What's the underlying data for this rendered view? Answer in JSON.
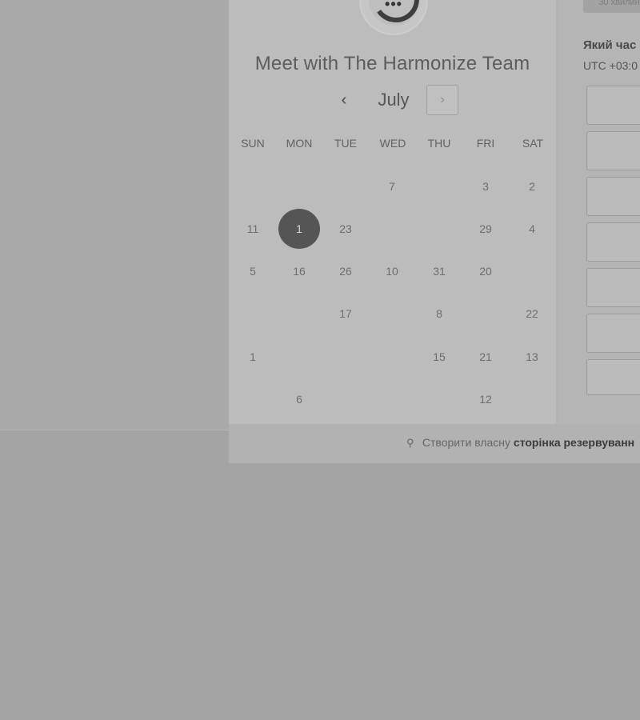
{
  "calendar": {
    "title": "Meet with The Harmonize Team",
    "month": "July",
    "prev_icon": "‹",
    "next_icon": "›",
    "weekdays": [
      "SUN",
      "MON",
      "TUE",
      "WED",
      "THU",
      "FRI",
      "SAT"
    ],
    "selected_day": "1",
    "rows": [
      [
        "",
        "",
        "",
        "7",
        "",
        "3",
        "2"
      ],
      [
        "11",
        "1",
        "23",
        "",
        "",
        "29",
        "4"
      ],
      [
        "5",
        "16",
        "26",
        "10",
        "31",
        "20",
        ""
      ],
      [
        "",
        "",
        "17",
        "",
        "8",
        "",
        "22"
      ],
      [
        "1",
        "",
        "",
        "",
        "15",
        "21",
        "13"
      ],
      [
        "",
        "6",
        "",
        "",
        "",
        "12",
        ""
      ]
    ]
  },
  "right": {
    "duration_label": "30 хвилин",
    "question": "Який час",
    "timezone": "UTC +03:0",
    "slot_count": 7
  },
  "footer": {
    "icon": "sprocket-icon",
    "text_plain": "Створити власну",
    "text_bold": "сторінка резервуванн"
  },
  "avatar": {
    "dots": "•••"
  },
  "colors": {
    "selected_day_bg": "#555555",
    "panel_bg": "#bcbcbc",
    "overlay_bg": "#a4a4a4"
  }
}
